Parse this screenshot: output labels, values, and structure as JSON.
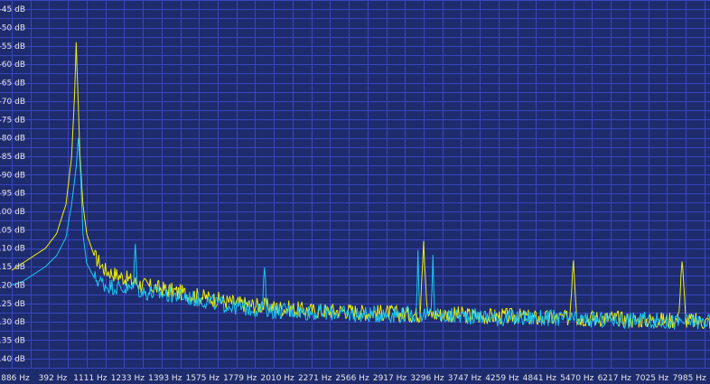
{
  "colors": {
    "background": "#1e2c6e",
    "grid": "#3a44c0",
    "series_yellow": "#f0f000",
    "series_cyan": "#19c8f0",
    "label": "#e6e6e6"
  },
  "chart_data": {
    "type": "line",
    "title": "",
    "xlabel": "",
    "ylabel": "",
    "y_unit": "dB",
    "grid": true,
    "ylim": [
      -142.5,
      -42.5
    ],
    "y_ticks": [
      "-45 dB",
      "-50 dB",
      "-55 dB",
      "-60 dB",
      "-65 dB",
      "-70 dB",
      "-75 dB",
      "-80 dB",
      "-85 dB",
      "-90 dB",
      "-95 dB",
      "-100 dB",
      "-105 dB",
      "-110 dB",
      "-115 dB",
      "-120 dB",
      "-125 dB",
      "-130 dB",
      "-135 dB",
      "-140 dB"
    ],
    "x_ticks": [
      "886 Hz",
      "392 Hz",
      "1111 Hz",
      "1233 Hz",
      "1393 Hz",
      "1575 Hz",
      "1779 Hz",
      "2010 Hz",
      "2271 Hz",
      "2566 Hz",
      "2917 Hz",
      "3296 Hz",
      "3747 Hz",
      "4259 Hz",
      "4841 Hz",
      "5470 Hz",
      "6217 Hz",
      "7025 Hz",
      "7985 Hz"
    ],
    "x_index_range": [
      0,
      19
    ],
    "series": [
      {
        "color": "yellow",
        "points": [
          [
            0.0,
            -116
          ],
          [
            0.3,
            -114
          ],
          [
            0.6,
            -112
          ],
          [
            0.9,
            -110
          ],
          [
            1.2,
            -106
          ],
          [
            1.45,
            -98
          ],
          [
            1.6,
            -85
          ],
          [
            1.68,
            -68
          ],
          [
            1.72,
            -54
          ],
          [
            1.76,
            -66
          ],
          [
            1.82,
            -84
          ],
          [
            1.9,
            -98
          ],
          [
            2.0,
            -106
          ],
          [
            2.2,
            -112
          ],
          [
            2.5,
            -116
          ],
          [
            3.0,
            -118
          ],
          [
            3.5,
            -120
          ],
          [
            4.0,
            -121
          ],
          [
            4.5,
            -122
          ],
          [
            5.0,
            -123
          ],
          [
            5.5,
            -124
          ],
          [
            6.0,
            -125
          ],
          [
            6.5,
            -125.5
          ],
          [
            7.0,
            -126
          ],
          [
            7.5,
            -126.5
          ],
          [
            8.0,
            -127
          ],
          [
            8.5,
            -127
          ],
          [
            9.0,
            -127
          ],
          [
            9.5,
            -127.5
          ],
          [
            10.0,
            -127.5
          ],
          [
            10.5,
            -128
          ],
          [
            10.9,
            -128
          ],
          [
            11.0,
            -107
          ],
          [
            11.1,
            -128
          ],
          [
            11.5,
            -128
          ],
          [
            12.0,
            -128
          ],
          [
            12.5,
            -128.5
          ],
          [
            13.0,
            -128.5
          ],
          [
            13.5,
            -128.5
          ],
          [
            14.0,
            -129
          ],
          [
            14.5,
            -129
          ],
          [
            14.9,
            -129
          ],
          [
            15.0,
            -112
          ],
          [
            15.1,
            -129
          ],
          [
            15.5,
            -129
          ],
          [
            16.0,
            -129
          ],
          [
            16.5,
            -129.5
          ],
          [
            17.0,
            -129.5
          ],
          [
            17.5,
            -129.5
          ],
          [
            17.8,
            -129.5
          ],
          [
            17.9,
            -113
          ],
          [
            18.0,
            -129.5
          ],
          [
            18.5,
            -130
          ],
          [
            19.0,
            -130
          ]
        ]
      },
      {
        "color": "cyan",
        "points": [
          [
            0.0,
            -120
          ],
          [
            0.3,
            -119
          ],
          [
            0.6,
            -117
          ],
          [
            0.9,
            -115
          ],
          [
            1.2,
            -112
          ],
          [
            1.45,
            -107
          ],
          [
            1.6,
            -98
          ],
          [
            1.72,
            -88
          ],
          [
            1.78,
            -80
          ],
          [
            1.84,
            -90
          ],
          [
            1.9,
            -106
          ],
          [
            2.0,
            -114
          ],
          [
            2.2,
            -118
          ],
          [
            2.5,
            -120
          ],
          [
            3.0,
            -121
          ],
          [
            3.25,
            -121
          ],
          [
            3.3,
            -107
          ],
          [
            3.35,
            -121
          ],
          [
            3.5,
            -122
          ],
          [
            4.0,
            -122.5
          ],
          [
            4.5,
            -123
          ],
          [
            5.0,
            -124
          ],
          [
            5.5,
            -125
          ],
          [
            6.0,
            -126
          ],
          [
            6.5,
            -126.5
          ],
          [
            6.7,
            -126.5
          ],
          [
            6.75,
            -114
          ],
          [
            6.8,
            -126.5
          ],
          [
            7.0,
            -127
          ],
          [
            7.5,
            -127
          ],
          [
            8.0,
            -127.5
          ],
          [
            8.5,
            -127.5
          ],
          [
            9.0,
            -128
          ],
          [
            9.5,
            -128
          ],
          [
            10.0,
            -128
          ],
          [
            10.5,
            -128
          ],
          [
            10.8,
            -128
          ],
          [
            10.85,
            -112
          ],
          [
            10.9,
            -128
          ],
          [
            11.2,
            -128
          ],
          [
            11.25,
            -113
          ],
          [
            11.3,
            -128
          ],
          [
            11.5,
            -128.5
          ],
          [
            12.0,
            -128.5
          ],
          [
            12.5,
            -128.5
          ],
          [
            13.0,
            -129
          ],
          [
            13.5,
            -129
          ],
          [
            14.0,
            -129
          ],
          [
            14.5,
            -129
          ],
          [
            15.0,
            -129.5
          ],
          [
            15.5,
            -129.5
          ],
          [
            16.0,
            -129.5
          ],
          [
            16.5,
            -129.5
          ],
          [
            17.0,
            -129.5
          ],
          [
            17.5,
            -130
          ],
          [
            18.0,
            -130
          ],
          [
            18.5,
            -130
          ],
          [
            19.0,
            -130
          ]
        ]
      }
    ]
  }
}
